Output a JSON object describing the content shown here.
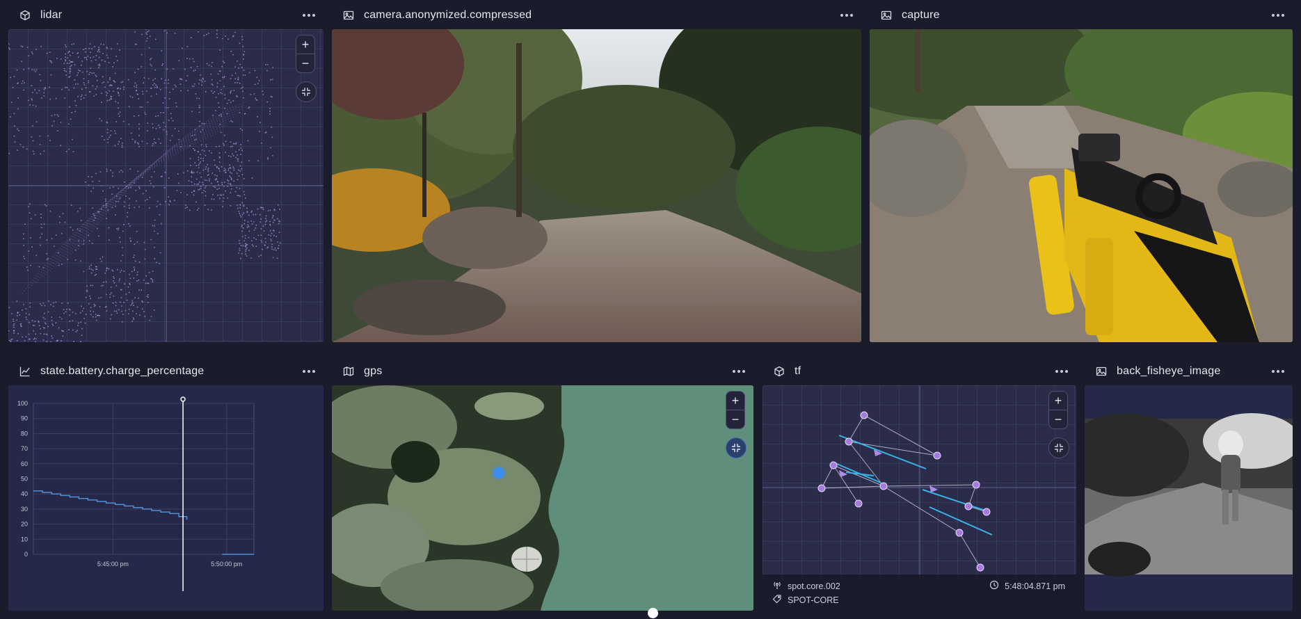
{
  "panels": {
    "lidar": {
      "title": "lidar",
      "icon": "cube-icon"
    },
    "camera": {
      "title": "camera.anonymized.compressed",
      "icon": "image-icon"
    },
    "capture": {
      "title": "capture",
      "icon": "image-icon"
    },
    "battery": {
      "title": "state.battery.charge_percentage",
      "icon": "line-chart-icon"
    },
    "gps": {
      "title": "gps",
      "icon": "map-icon"
    },
    "tf": {
      "title": "tf",
      "icon": "cube-icon",
      "frame_name": "spot.core.002",
      "tag": "SPOT-CORE",
      "timestamp": "5:48:04.871 pm"
    },
    "fisheye": {
      "title": "back_fisheye_image",
      "icon": "image-icon"
    }
  },
  "controls": {
    "zoom_in": "+",
    "zoom_out": "−"
  },
  "colors": {
    "background": "#1a1b2b",
    "panel": "#2b2c4a",
    "line": "#4f8fd6",
    "lidar_points": "#a79bdc",
    "gps_marker": "#3f8cf0",
    "tf_lines": "#36b6e8"
  },
  "chart_data": {
    "type": "line",
    "title": "",
    "xlabel": "",
    "ylabel": "",
    "ylim": [
      0,
      100
    ],
    "y_ticks": [
      "100",
      "90",
      "80",
      "70",
      "60",
      "50",
      "40",
      "30",
      "20",
      "10",
      "0"
    ],
    "x_tick_labels": [
      "5:45:00 pm",
      "5:50:00 pm"
    ],
    "x_tick_minutes": [
      45,
      50
    ],
    "x_range_minutes": [
      41.5,
      51.2
    ],
    "cursor_minutes": 48.08,
    "series": [
      {
        "name": "",
        "x_minutes": [
          41.5,
          41.9,
          42.3,
          42.7,
          43.1,
          43.5,
          43.9,
          44.3,
          44.7,
          45.1,
          45.5,
          45.9,
          46.3,
          46.7,
          47.1,
          47.5,
          47.9,
          48.25
        ],
        "values": [
          42,
          41,
          40,
          39,
          38,
          37,
          36,
          35,
          34,
          33,
          32,
          31,
          30,
          29,
          28,
          27,
          25,
          23
        ]
      }
    ]
  }
}
